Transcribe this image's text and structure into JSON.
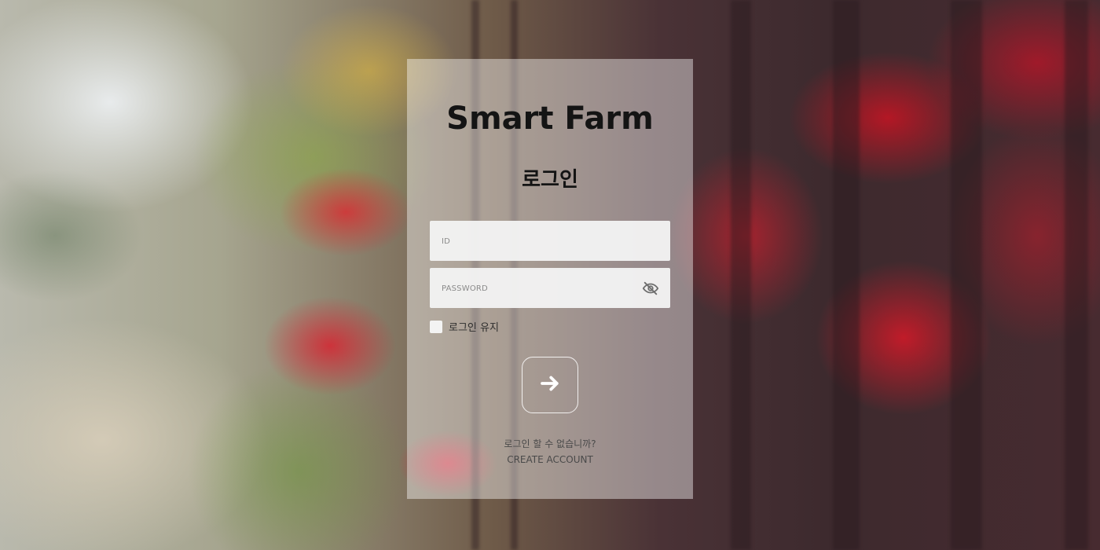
{
  "login": {
    "title": "Smart Farm",
    "subtitle": "로그인",
    "id_field": {
      "placeholder": "ID",
      "value": ""
    },
    "password_field": {
      "placeholder": "PASSWORD",
      "value": ""
    },
    "password_toggle_icon": "eye-slash-icon",
    "remember_label": "로그인 유지",
    "remember_checked": false,
    "submit_icon": "arrow-right-icon",
    "no_account_text": "로그인 할 수 없습니까?",
    "create_account_label": "CREATE ACCOUNT"
  },
  "colors": {
    "card_overlay": "#ffffff",
    "title_text": "#141414",
    "field_background": "#f2f2f2",
    "muted_text": "#4a4a4a"
  }
}
